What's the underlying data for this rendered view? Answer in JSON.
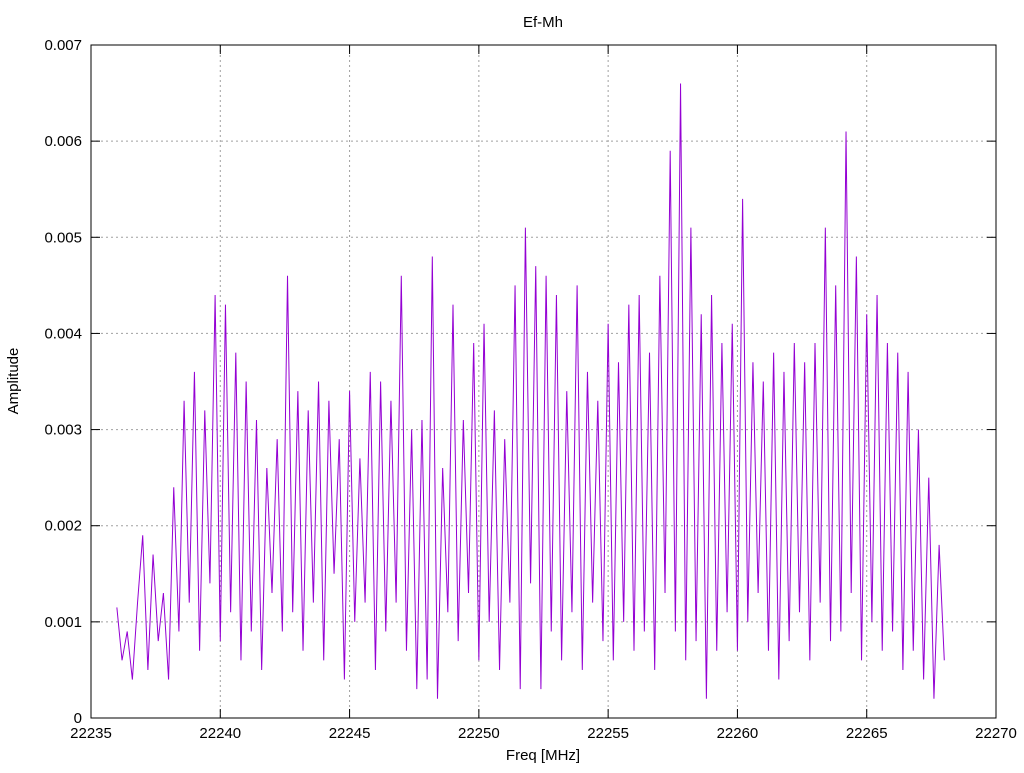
{
  "chart_data": {
    "type": "line",
    "title": "Ef-Mh",
    "xlabel": "Freq [MHz]",
    "ylabel": "Amplitude",
    "xlim": [
      22235,
      22270
    ],
    "ylim": [
      0,
      0.007
    ],
    "grid": true,
    "legend": "none",
    "x_ticks": [
      "22235",
      "22240",
      "22245",
      "22250",
      "22255",
      "22260",
      "22265",
      "22270"
    ],
    "y_ticks": [
      "0",
      "0.001",
      "0.002",
      "0.003",
      "0.004",
      "0.005",
      "0.006",
      "0.007"
    ],
    "series": [
      {
        "name": "Ef-Mh",
        "color": "#9400d3",
        "x_start": 22236,
        "x_step": 0.2,
        "values": [
          0.00115,
          0.0006,
          0.0009,
          0.0004,
          0.0012,
          0.0019,
          0.0005,
          0.0017,
          0.0008,
          0.0013,
          0.0004,
          0.0024,
          0.0009,
          0.0033,
          0.0012,
          0.0036,
          0.0007,
          0.0032,
          0.0014,
          0.0044,
          0.0008,
          0.0043,
          0.0011,
          0.0038,
          0.0006,
          0.0035,
          0.0009,
          0.0031,
          0.0005,
          0.0026,
          0.0013,
          0.0029,
          0.0009,
          0.0046,
          0.0011,
          0.0034,
          0.0007,
          0.0032,
          0.0012,
          0.0035,
          0.0006,
          0.0033,
          0.0015,
          0.0029,
          0.0004,
          0.0034,
          0.001,
          0.0027,
          0.0012,
          0.0036,
          0.0005,
          0.0035,
          0.0009,
          0.0033,
          0.0012,
          0.0046,
          0.0007,
          0.003,
          0.0003,
          0.0031,
          0.0004,
          0.0048,
          0.0002,
          0.0026,
          0.0011,
          0.0043,
          0.0008,
          0.0031,
          0.0013,
          0.0039,
          0.0006,
          0.0041,
          0.001,
          0.0032,
          0.0005,
          0.0029,
          0.0012,
          0.0045,
          0.0003,
          0.0051,
          0.0014,
          0.0047,
          0.0003,
          0.0046,
          0.0009,
          0.0044,
          0.0006,
          0.0034,
          0.0011,
          0.0045,
          0.0005,
          0.0036,
          0.0012,
          0.0033,
          0.0008,
          0.0041,
          0.0006,
          0.0037,
          0.001,
          0.0043,
          0.0007,
          0.0044,
          0.0009,
          0.0038,
          0.0005,
          0.0046,
          0.0013,
          0.0059,
          0.0009,
          0.0066,
          0.0006,
          0.0051,
          0.0008,
          0.0042,
          0.0002,
          0.0044,
          0.0007,
          0.0039,
          0.0011,
          0.0041,
          0.0007,
          0.0054,
          0.001,
          0.0037,
          0.0013,
          0.0035,
          0.0007,
          0.0038,
          0.0004,
          0.0036,
          0.0008,
          0.0039,
          0.0011,
          0.0037,
          0.0006,
          0.0039,
          0.0012,
          0.0051,
          0.0008,
          0.0045,
          0.0009,
          0.0061,
          0.0013,
          0.0048,
          0.0006,
          0.0042,
          0.001,
          0.0044,
          0.0007,
          0.0039,
          0.0009,
          0.0038,
          0.0005,
          0.0036,
          0.0007,
          0.003,
          0.0004,
          0.0025,
          0.0002,
          0.0018,
          0.0006
        ]
      }
    ]
  }
}
